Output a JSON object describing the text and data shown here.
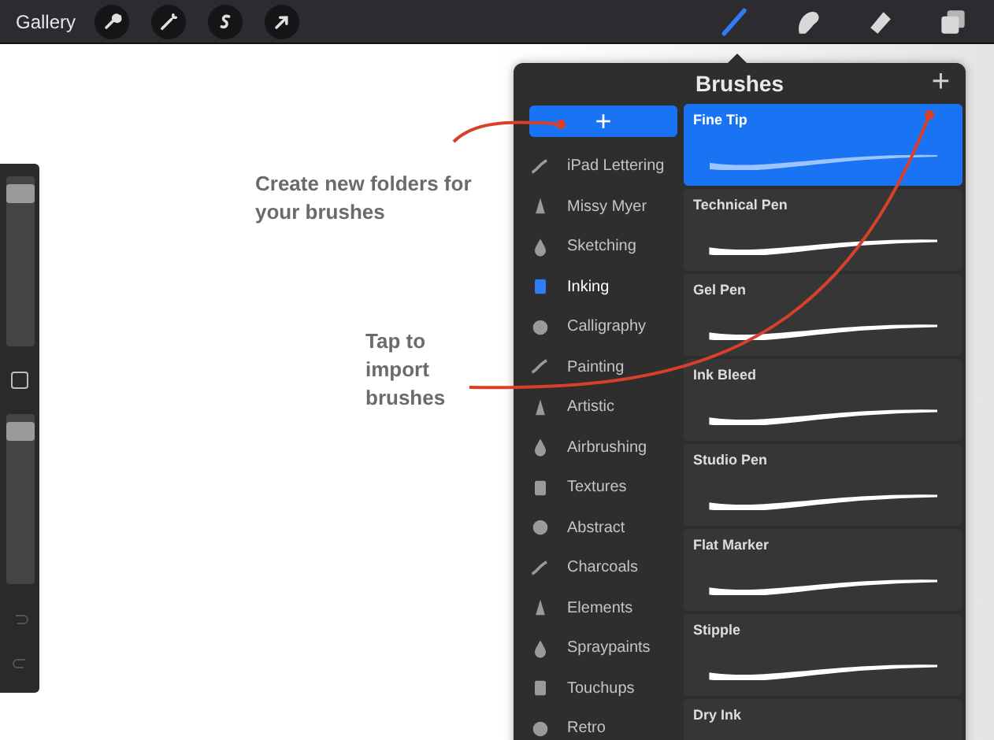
{
  "top_bar": {
    "gallery": "Gallery",
    "tools": [
      {
        "selected": true
      },
      {
        "selected": false
      },
      {
        "selected": false
      },
      {
        "selected": false
      }
    ]
  },
  "side_bar": {
    "sliders": [
      {
        "level": 0.95
      },
      {
        "level": 0.95
      }
    ]
  },
  "panel": {
    "title": "Brushes",
    "add": "+",
    "new_folder": "+",
    "categories": [
      {
        "label": "iPad Lettering",
        "selected": false
      },
      {
        "label": "Missy Myer",
        "selected": false
      },
      {
        "label": "Sketching",
        "selected": false
      },
      {
        "label": "Inking",
        "selected": true
      },
      {
        "label": "Calligraphy",
        "selected": false
      },
      {
        "label": "Painting",
        "selected": false
      },
      {
        "label": "Artistic",
        "selected": false
      },
      {
        "label": "Airbrushing",
        "selected": false
      },
      {
        "label": "Textures",
        "selected": false
      },
      {
        "label": "Abstract",
        "selected": false
      },
      {
        "label": "Charcoals",
        "selected": false
      },
      {
        "label": "Elements",
        "selected": false
      },
      {
        "label": "Spraypaints",
        "selected": false
      },
      {
        "label": "Touchups",
        "selected": false
      },
      {
        "label": "Retro",
        "selected": false
      }
    ],
    "brushes": [
      {
        "name": "Fine Tip",
        "selected": true
      },
      {
        "name": "Technical Pen",
        "selected": false
      },
      {
        "name": "Gel Pen",
        "selected": false
      },
      {
        "name": "Ink Bleed",
        "selected": false
      },
      {
        "name": "Studio Pen",
        "selected": false
      },
      {
        "name": "Flat Marker",
        "selected": false
      },
      {
        "name": "Stipple",
        "selected": false
      },
      {
        "name": "Dry Ink",
        "selected": false
      }
    ]
  },
  "annotations": [
    "Create new folders for your brushes",
    "Tap to import brushes"
  ]
}
